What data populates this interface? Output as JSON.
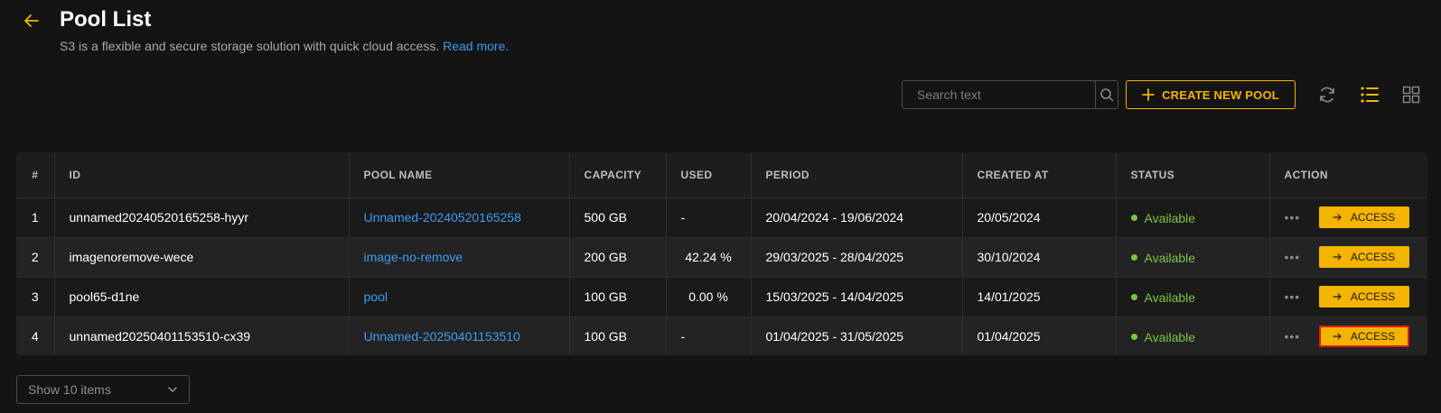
{
  "header": {
    "title": "Pool List",
    "subtitle": "S3 is a flexible and secure storage solution with quick cloud access.",
    "read_more": "Read more."
  },
  "toolbar": {
    "search_placeholder": "Search text",
    "create_label": "CREATE NEW POOL",
    "accent_color": "#f5b400"
  },
  "table": {
    "columns": [
      "#",
      "ID",
      "POOL NAME",
      "CAPACITY",
      "USED",
      "PERIOD",
      "CREATED AT",
      "STATUS",
      "ACTION"
    ],
    "rows": [
      {
        "index": "1",
        "id": "unnamed20240520165258-hyyr",
        "pool_name": "Unnamed-20240520165258",
        "capacity": "500 GB",
        "used": "-",
        "period": "20/04/2024 - 19/06/2024",
        "created_at": "20/05/2024",
        "status": "Available",
        "action_more": "•••",
        "action": "ACCESS"
      },
      {
        "index": "2",
        "id": "imagenoremove-wece",
        "pool_name": "image-no-remove",
        "capacity": "200 GB",
        "used": "42.24 %",
        "period": "29/03/2025 - 28/04/2025",
        "created_at": "30/10/2024",
        "status": "Available",
        "action_more": "•••",
        "action": "ACCESS"
      },
      {
        "index": "3",
        "id": "pool65-d1ne",
        "pool_name": "pool",
        "capacity": "100 GB",
        "used": "0.00 %",
        "period": "15/03/2025 - 14/04/2025",
        "created_at": "14/01/2025",
        "status": "Available",
        "action_more": "•••",
        "action": "ACCESS"
      },
      {
        "index": "4",
        "id": "unnamed20250401153510-cx39",
        "pool_name": "Unnamed-20250401153510",
        "capacity": "100 GB",
        "used": "-",
        "period": "01/04/2025 - 31/05/2025",
        "created_at": "01/04/2025",
        "status": "Available",
        "action_more": "•••",
        "action": "ACCESS"
      }
    ]
  },
  "pagination": {
    "page_size_label": "Show 10 items"
  },
  "icons": {
    "back": "arrow-left-icon",
    "search": "search-icon",
    "create": "plus-icon",
    "refresh": "refresh-icon",
    "list_view": "list-view-icon",
    "grid_view": "grid-view-icon",
    "access": "arrow-right-icon",
    "dropdown": "chevron-down-icon"
  }
}
